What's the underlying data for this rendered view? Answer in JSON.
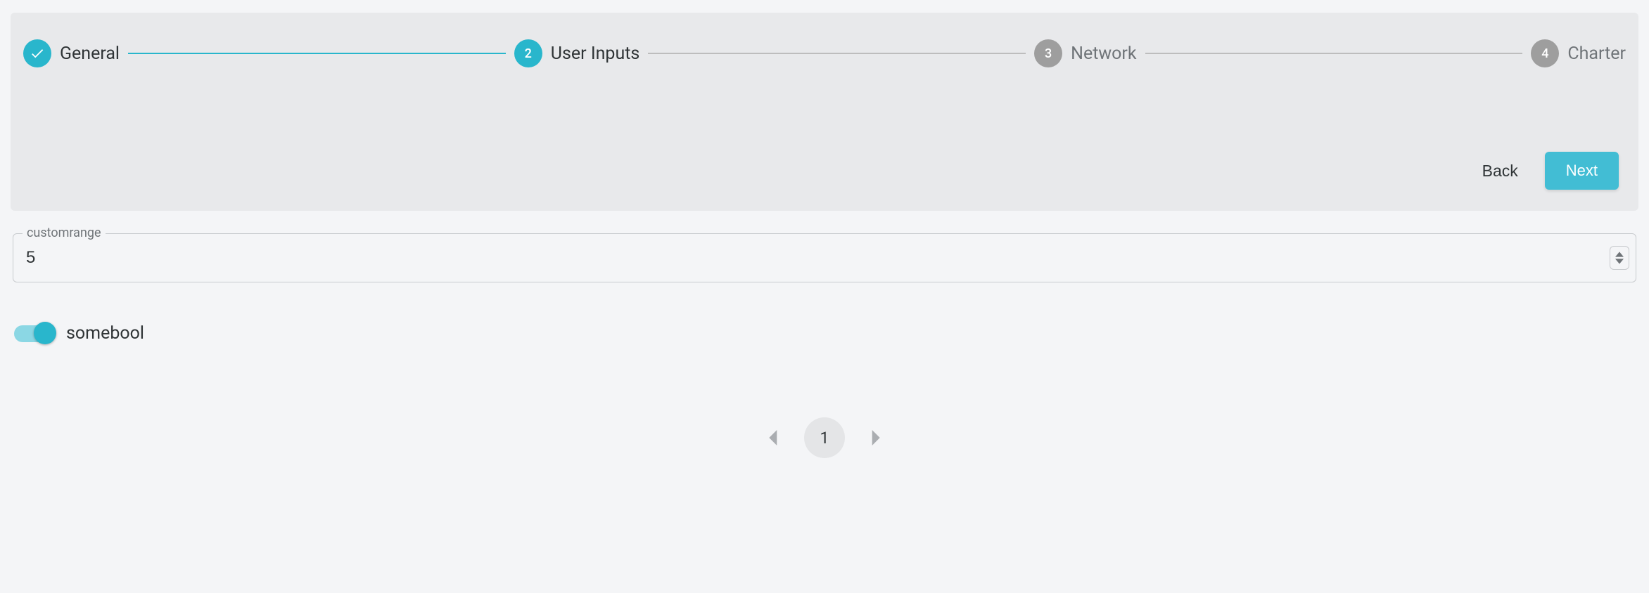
{
  "stepper": {
    "steps": [
      {
        "label": "General",
        "state": "completed"
      },
      {
        "label": "User Inputs",
        "state": "active",
        "num": "2"
      },
      {
        "label": "Network",
        "state": "pending",
        "num": "3"
      },
      {
        "label": "Charter",
        "state": "pending",
        "num": "4"
      }
    ]
  },
  "nav": {
    "back_label": "Back",
    "next_label": "Next"
  },
  "form": {
    "customrange": {
      "label": "customrange",
      "value": "5"
    },
    "somebool": {
      "label": "somebool",
      "value": true
    }
  },
  "pagination": {
    "current": "1"
  },
  "colors": {
    "accent": "#29b6cc",
    "pending": "#9e9e9e"
  }
}
